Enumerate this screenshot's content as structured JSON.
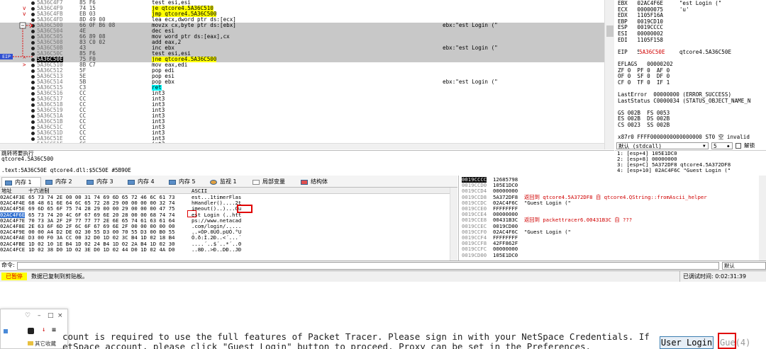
{
  "disasm": {
    "eip_label": "EIP",
    "rows": [
      {
        "addr": "5A36C4F7",
        "bytes": "85 F6",
        "ins": "test esi,esi",
        "com": "",
        "hl": false,
        "mark": "",
        "ins_style": ""
      },
      {
        "addr": "5A36C4F9",
        "bytes": "74 15",
        "ins": "je qtcore4.5A36C510",
        "com": "",
        "hl": false,
        "mark": "v",
        "ins_style": "jmp"
      },
      {
        "addr": "5A36C4FB",
        "bytes": "EB 03",
        "ins": "jmp qtcore4.5A36C500",
        "com": "",
        "hl": false,
        "mark": "v",
        "ins_style": "jmp"
      },
      {
        "addr": "5A36C4FD",
        "bytes": "8D 49 00",
        "ins": "lea ecx,dword ptr ds:[ecx]",
        "com": "",
        "hl": false,
        "mark": "",
        "ins_style": ""
      },
      {
        "addr": "5A36C500",
        "bytes": "66 0F B6 08",
        "ins": "movzx cx,byte ptr ds:[ebx]",
        "com": "ebx:\"est Login (\"",
        "hl": true,
        "mark": "",
        "ins_style": ""
      },
      {
        "addr": "5A36C504",
        "bytes": "4E",
        "ins": "dec esi",
        "com": "",
        "hl": true,
        "mark": "",
        "ins_style": ""
      },
      {
        "addr": "5A36C505",
        "bytes": "66 89 08",
        "ins": "mov word ptr ds:[eax],cx",
        "com": "",
        "hl": true,
        "mark": "",
        "ins_style": ""
      },
      {
        "addr": "5A36C508",
        "bytes": "83 C0 02",
        "ins": "add eax,2",
        "com": "",
        "hl": true,
        "mark": "",
        "ins_style": ""
      },
      {
        "addr": "5A36C50B",
        "bytes": "43",
        "ins": "inc ebx",
        "com": "ebx:\"est Login (\"",
        "hl": true,
        "mark": "",
        "ins_style": ""
      },
      {
        "addr": "5A36C50C",
        "bytes": "85 F6",
        "ins": "test esi,esi",
        "com": "",
        "hl": true,
        "mark": "",
        "ins_style": ""
      },
      {
        "addr": "5A36C50E",
        "bytes": "75 F0",
        "ins": "jne qtcore4.5A36C500",
        "com": "",
        "hl": true,
        "mark": "^",
        "ins_style": "jmp",
        "cur": true
      },
      {
        "addr": "5A36C510",
        "bytes": "8B C7",
        "ins": "mov eax,edi",
        "com": "",
        "hl": false,
        "mark": ">",
        "ins_style": ""
      },
      {
        "addr": "5A36C512",
        "bytes": "5F",
        "ins": "pop edi",
        "com": "",
        "hl": false,
        "mark": "",
        "ins_style": ""
      },
      {
        "addr": "5A36C513",
        "bytes": "5E",
        "ins": "pop esi",
        "com": "",
        "hl": false,
        "mark": "",
        "ins_style": ""
      },
      {
        "addr": "5A36C514",
        "bytes": "5B",
        "ins": "pop ebx",
        "com": "ebx:\"est Login (\"",
        "hl": false,
        "mark": "",
        "ins_style": ""
      },
      {
        "addr": "5A36C515",
        "bytes": "C3",
        "ins": "ret",
        "com": "",
        "hl": false,
        "mark": "",
        "ins_style": "ret"
      },
      {
        "addr": "5A36C516",
        "bytes": "CC",
        "ins": "int3",
        "com": "",
        "hl": false,
        "mark": "",
        "ins_style": ""
      },
      {
        "addr": "5A36C517",
        "bytes": "CC",
        "ins": "int3",
        "com": "",
        "hl": false,
        "mark": "",
        "ins_style": ""
      },
      {
        "addr": "5A36C518",
        "bytes": "CC",
        "ins": "int3",
        "com": "",
        "hl": false,
        "mark": "",
        "ins_style": ""
      },
      {
        "addr": "5A36C519",
        "bytes": "CC",
        "ins": "int3",
        "com": "",
        "hl": false,
        "mark": "",
        "ins_style": ""
      },
      {
        "addr": "5A36C51A",
        "bytes": "CC",
        "ins": "int3",
        "com": "",
        "hl": false,
        "mark": "",
        "ins_style": ""
      },
      {
        "addr": "5A36C51B",
        "bytes": "CC",
        "ins": "int3",
        "com": "",
        "hl": false,
        "mark": "",
        "ins_style": ""
      },
      {
        "addr": "5A36C51C",
        "bytes": "CC",
        "ins": "int3",
        "com": "",
        "hl": false,
        "mark": "",
        "ins_style": ""
      },
      {
        "addr": "5A36C51D",
        "bytes": "CC",
        "ins": "int3",
        "com": "",
        "hl": false,
        "mark": "",
        "ins_style": ""
      },
      {
        "addr": "5A36C51E",
        "bytes": "CC",
        "ins": "int3",
        "com": "",
        "hl": false,
        "mark": "",
        "ins_style": ""
      },
      {
        "addr": "5A36C51F",
        "bytes": "CC",
        "ins": "int3",
        "com": "",
        "hl": false,
        "mark": "",
        "ins_style": ""
      }
    ]
  },
  "registers": {
    "rows": [
      {
        "t": "EBX   02AC4F6E     \"est Login (\"",
        "red": false
      },
      {
        "t": "ECX   00000075     'u'",
        "red": false
      },
      {
        "t": "EDX   1105F16A",
        "red": false
      },
      {
        "t": "EBP   0019CD10",
        "red": false
      },
      {
        "t": "ESP   0019CCCC",
        "red": false
      },
      {
        "t": "ESI   00000002",
        "red": false
      },
      {
        "t": "EDI   1105F158",
        "red": false
      },
      {
        "t": "",
        "red": false
      },
      {
        "t": "EIP   5A36C50E     qtcore4.5A36C50E",
        "red": false
      },
      {
        "t": "",
        "red": false
      },
      {
        "t": "EFLAGS   00000202",
        "red": false
      },
      {
        "t": "ZF 0  PF 0  AF 0",
        "red": false
      },
      {
        "t": "OF 0  SF 0  DF 0",
        "red": false
      },
      {
        "t": "CF 0  TF 0  IF 1",
        "red": false
      },
      {
        "t": "",
        "red": false
      },
      {
        "t": "LastError  00000000 (ERROR_SUCCESS)",
        "red": false
      },
      {
        "t": "LastStatus C0000034 (STATUS_OBJECT_NAME_N",
        "red": false
      },
      {
        "t": "",
        "red": false
      },
      {
        "t": "GS 002B  FS 0053",
        "red": false
      },
      {
        "t": "ES 002B  DS 002B",
        "red": false
      },
      {
        "t": "CS 0023  SS 002B",
        "red": false
      },
      {
        "t": "",
        "red": false
      },
      {
        "t": "x87r0 FFFF0000000000000000 ST0 空 invalid",
        "red": false
      }
    ],
    "eip_value": "5A36C50E",
    "callconv": "默认 (stdcall)",
    "arg_count": "5",
    "unlock_label": "解锁",
    "stack_args": [
      "1: [esp+4] 105E1DC0",
      "2: [esp+8] 00000000",
      "3: [esp+C] 5A372DF8 qtcore4.5A372DF8",
      "4: [esp+10] 02AC4F6C \"Guest Login (\""
    ]
  },
  "info": {
    "lines": [
      "跳转将要执行",
      "qtcore4.5A36C500",
      "",
      ".text:5A36C50E qtcore4.dll:$5C50E #5B90E"
    ]
  },
  "tabs": [
    {
      "label": "内存 1",
      "icon": "memory-icon",
      "active": true
    },
    {
      "label": "内存 2",
      "icon": "memory-icon",
      "active": false
    },
    {
      "label": "内存 3",
      "icon": "memory-icon",
      "active": false
    },
    {
      "label": "内存 4",
      "icon": "memory-icon",
      "active": false
    },
    {
      "label": "内存 5",
      "icon": "memory-icon",
      "active": false
    },
    {
      "label": "监视 1",
      "icon": "watch-icon",
      "active": false
    },
    {
      "label": "局部变量",
      "icon": "locals-icon",
      "active": false
    },
    {
      "label": "结构体",
      "icon": "struct-icon",
      "active": false
    }
  ],
  "dump": {
    "col_addr": "地址",
    "col_hex": "十六进制",
    "col_ascii": "ASCII",
    "rows": [
      {
        "addr": "02AC4F3E",
        "hex": "65 73 74 2E 00 00 31 74 69 6D 65 72 46 6C 61 73",
        "asc": "est...1timerFlas"
      },
      {
        "addr": "02AC4F4E",
        "hex": "68 48 61 6E 64 6C 65 72 28 29 00 00 00 00 32 74",
        "asc": "hHandler()....2t"
      },
      {
        "addr": "02AC4F5E",
        "hex": "69 6D 65 6F 75 74 28 29 00 00 29 00 00 00 47 75",
        "asc": "imeout()..)...Gu"
      },
      {
        "addr": "02AC4F6E",
        "hex": "65 73 74 20 4C 6F 67 69 6E 20 28 00 00 68 74 74",
        "asc": "est Login (..htt",
        "sel": true
      },
      {
        "addr": "02AC4F7E",
        "hex": "70 73 3A 2F 2F 77 77 77 2E 6E 65 74 61 63 61 64",
        "asc": "ps://www.netacad"
      },
      {
        "addr": "02AC4F8E",
        "hex": "2E 63 6F 6D 2F 6C 6F 67 69 6E 2F 00 00 00 00 00",
        "asc": ".com/login/....."
      },
      {
        "addr": "02AC4F9E",
        "hex": "00 00 A4 D2 DE 02 30 55 D3 00 70 55 D3 00 B0 55",
        "asc": "..¤ÒÞ.0UÓ.pUÓ.°U"
      },
      {
        "addr": "02AC4FAE",
        "hex": "D3 00 F0 3A CC 00 32 D0 1D 02 3C B4 1D 02 18 B4",
        "asc": "Ó.ð:Ì.2Ð..<´...´"
      },
      {
        "addr": "02AC4FBE",
        "hex": "1D 02 10 1E B4 1D 02 24 B4 1D 02 2A B4 1D 02 30",
        "asc": "....´..$´..*´..0"
      },
      {
        "addr": "02AC4FCE",
        "hex": "1D 02 38 D0 1D 02 3E D0 1D 02 44 D0 1D 02 4A D0",
        "asc": "..8Ð..>Ð..DÐ..JÐ"
      }
    ]
  },
  "stack": {
    "rows": [
      {
        "addr": "0019CCCC",
        "val": "12685798",
        "com": "",
        "red": false,
        "sel": true
      },
      {
        "addr": "0019CCD0",
        "val": "105E1DC0",
        "com": "",
        "red": false
      },
      {
        "addr": "0019CCD4",
        "val": "00000000",
        "com": "",
        "red": false
      },
      {
        "addr": "0019CCD8",
        "val": "5A372DF8",
        "com": "返回到 qtcore4.5A372DF8 自 qtcore4.QString::fromAscii_helper",
        "red": true
      },
      {
        "addr": "0019CCDC",
        "val": "02AC4F6C",
        "com": "\"Guest Login (\"",
        "red": false
      },
      {
        "addr": "0019CCE0",
        "val": "FFFFFFFF",
        "com": "",
        "red": false
      },
      {
        "addr": "0019CCE4",
        "val": "00000000",
        "com": "",
        "red": false
      },
      {
        "addr": "0019CCE8",
        "val": "00431B3C",
        "com": "返回到 packettracer6.00431B3C 自 ???",
        "red": true
      },
      {
        "addr": "0019CCEC",
        "val": "0019CD00",
        "com": "",
        "red": false
      },
      {
        "addr": "0019CCF0",
        "val": "02AC4F6C",
        "com": "\"Guest Login (\"",
        "red": false
      },
      {
        "addr": "0019CCF4",
        "val": "FFFFFFFF",
        "com": "",
        "red": false
      },
      {
        "addr": "0019CCF8",
        "val": "42FF862F",
        "com": "",
        "red": false
      },
      {
        "addr": "0019CCFC",
        "val": "00000000",
        "com": "",
        "red": false
      },
      {
        "addr": "0019CD00",
        "val": "105E1DC0",
        "com": "",
        "red": false
      }
    ]
  },
  "command": {
    "label": "命令:",
    "mode": "默认"
  },
  "status": {
    "state": "已暂停",
    "message": "数据已复制到剪贴板。",
    "time": "已调试时间:  0:02:31:39"
  },
  "bottom": {
    "window_buttons": [
      "♡",
      "–",
      "□",
      "×"
    ],
    "folder_label": "其它收藏",
    "message_line1": "count is required to use the full features of Packet Tracer. Please sign in with your NetSpace Credentials. If",
    "message_line2": "etSpace account, please click \"Guest Login\" button to proceed. Proxy can be set in the Preferences.",
    "user_login": "User Login",
    "guest_login": "Gue(4)"
  },
  "colors": {
    "highlight_row": "#c8c8c8",
    "jump": "#ffff00",
    "ret": "#00ffff",
    "alert": "#e00000",
    "eip": "#3050d0"
  }
}
